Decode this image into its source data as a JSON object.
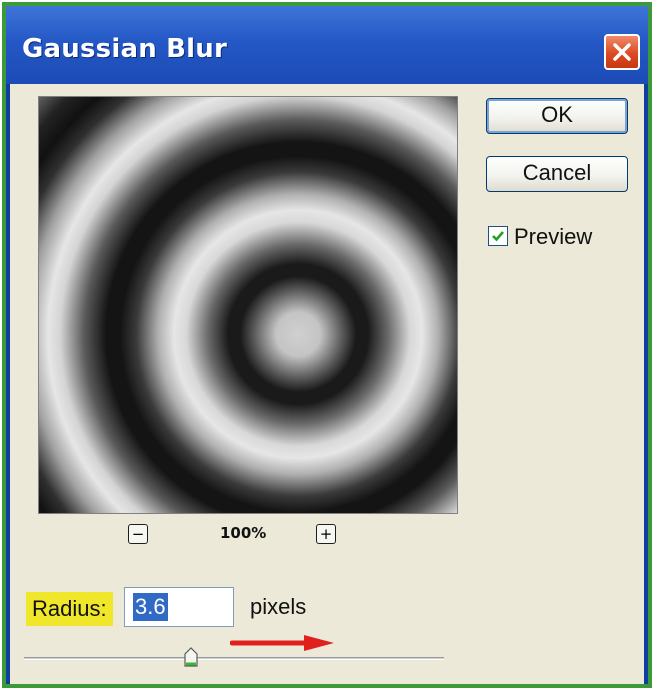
{
  "window": {
    "title": "Gaussian Blur"
  },
  "preview": {
    "zoom_level": "100%",
    "zoom_out_symbol": "−",
    "zoom_in_symbol": "+"
  },
  "buttons": {
    "ok_label": "OK",
    "cancel_label": "Cancel"
  },
  "preview_checkbox": {
    "label": "Preview",
    "checked": true
  },
  "radius": {
    "label": "Radius:",
    "value": "3.6",
    "unit": "pixels",
    "slider_fraction": 0.42
  },
  "colors": {
    "title_bar": "#2458c6",
    "dialog_bg": "#ece9d8",
    "label_highlight": "#f0e62a",
    "selection": "#316ac5",
    "annotation_arrow": "#e0201c",
    "close_button": "#dc4a24"
  },
  "icons": {
    "close": "close-x-icon",
    "check": "checkmark-icon",
    "arrow": "right-arrow-icon",
    "thumb": "slider-thumb-icon"
  }
}
